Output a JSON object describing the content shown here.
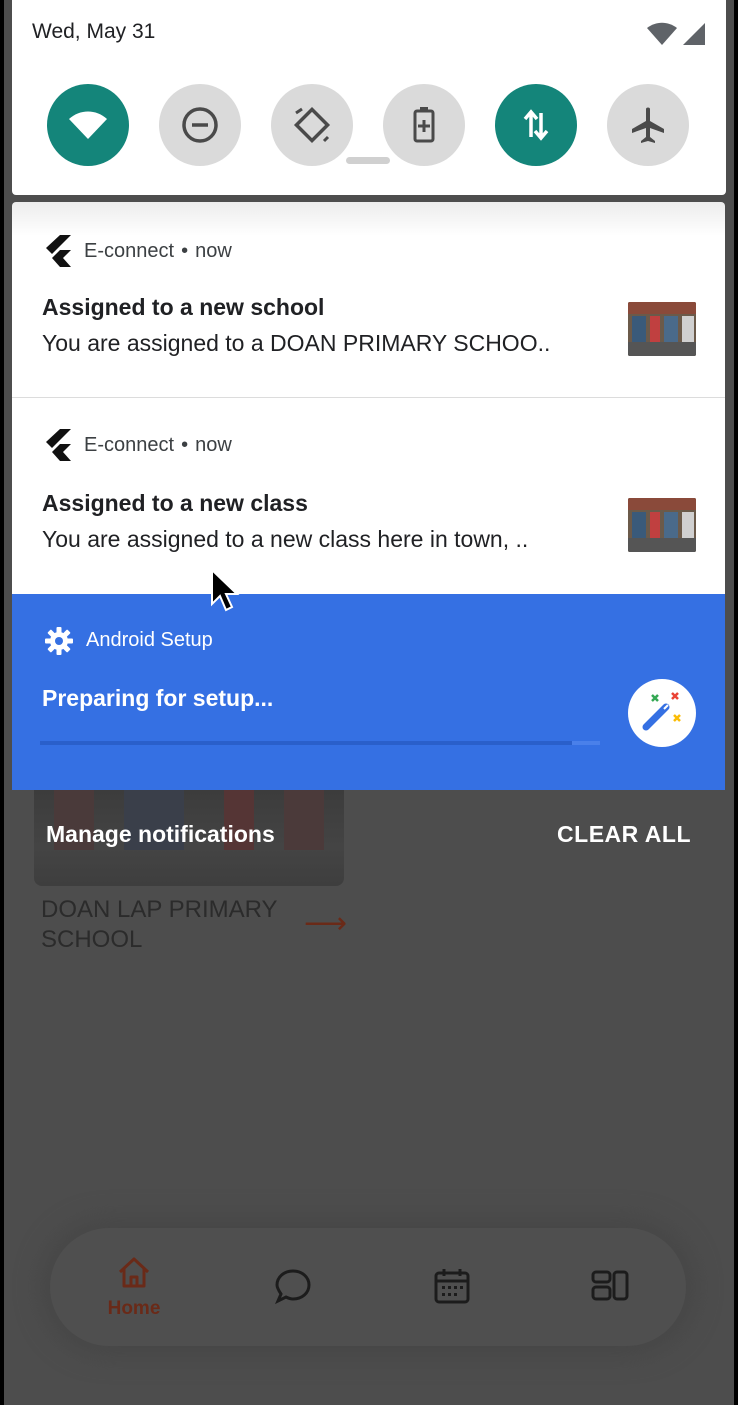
{
  "status_bar": {
    "date": "Wed, May 31",
    "icons": [
      "wifi-signal-icon",
      "cell-signal-icon"
    ]
  },
  "quick_settings": {
    "tiles": [
      {
        "name": "wifi",
        "icon": "wifi-icon",
        "active": true
      },
      {
        "name": "do-not-disturb",
        "icon": "minus-circle-icon",
        "active": false
      },
      {
        "name": "auto-rotate",
        "icon": "rotate-icon",
        "active": false
      },
      {
        "name": "battery-saver",
        "icon": "battery-plus-icon",
        "active": false
      },
      {
        "name": "mobile-data",
        "icon": "up-down-arrows-icon",
        "active": true
      },
      {
        "name": "airplane-mode",
        "icon": "airplane-icon",
        "active": false
      }
    ],
    "active_color": "#14857a",
    "inactive_color": "#dadada"
  },
  "notifications": [
    {
      "app": "E-connect",
      "separator": "•",
      "time": "now",
      "title": "Assigned to a new school",
      "text": "You are assigned to a DOAN PRIMARY SCHOO..",
      "thumbnail": "school-photo"
    },
    {
      "app": "E-connect",
      "separator": "•",
      "time": "now",
      "title": "Assigned to a new class",
      "text": "You are assigned to a new class here in town, ..",
      "thumbnail": "school-photo"
    }
  ],
  "setup_notification": {
    "app": "Android Setup",
    "title": "Preparing for setup...",
    "icon": "magic-wand-icon",
    "background": "#3570e3",
    "progress": 0.95
  },
  "shade_actions": {
    "manage": "Manage notifications",
    "clear_all": "CLEAR ALL"
  },
  "background_app": {
    "school_name": "DOAN LAP PRIMARY SCHOOL",
    "nav": {
      "home_label": "Home",
      "items": [
        "home-icon",
        "chat-icon",
        "calendar-icon",
        "dashboard-icon"
      ]
    }
  }
}
